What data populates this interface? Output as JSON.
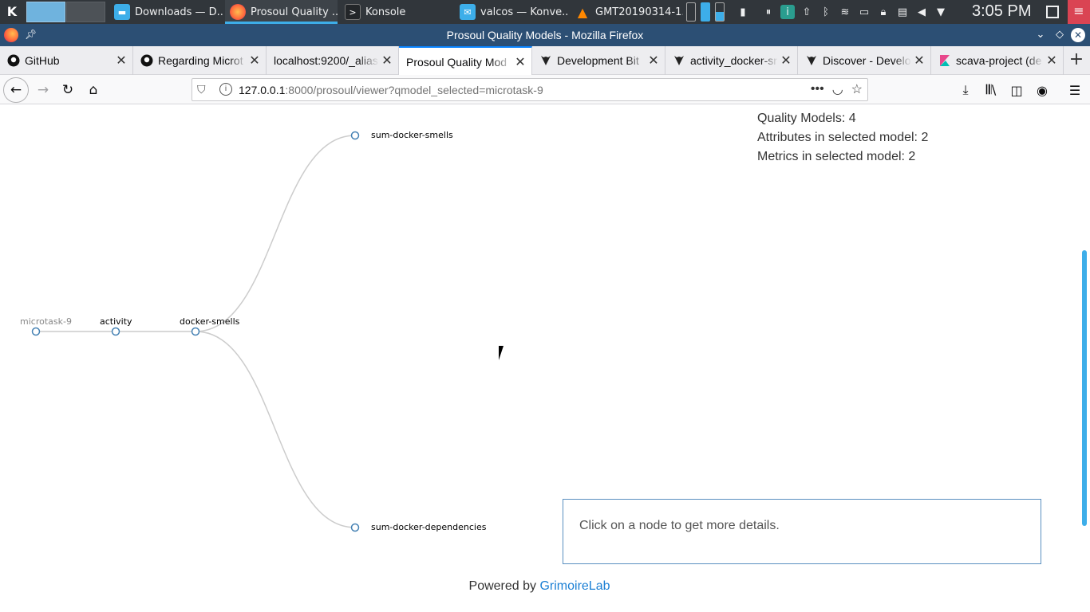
{
  "taskbar": {
    "tasks": [
      {
        "label": "Downloads — D...",
        "icon": "folder-icon"
      },
      {
        "label": "Prosoul Quality ...",
        "icon": "firefox-icon"
      },
      {
        "label": "Konsole",
        "icon": "terminal-icon"
      },
      {
        "label": "valcos — Konve...",
        "icon": "chat-icon"
      },
      {
        "label": "GMT20190314-1...",
        "icon": "vlc-icon"
      }
    ],
    "clock": "3:05 PM"
  },
  "window": {
    "title": "Prosoul Quality Models - Mozilla Firefox"
  },
  "tabs": [
    {
      "title": "GitHub",
      "icon": "github-icon"
    },
    {
      "title": "Regarding Microt",
      "icon": "github-icon"
    },
    {
      "title": "localhost:9200/_alias",
      "icon": ""
    },
    {
      "title": "Prosoul Quality Mod",
      "icon": ""
    },
    {
      "title": "Development Bit",
      "icon": "bitergia-icon"
    },
    {
      "title": "activity_docker-sr",
      "icon": "bitergia-icon"
    },
    {
      "title": "Discover - Develo",
      "icon": "bitergia-icon"
    },
    {
      "title": "scava-project (de",
      "icon": "kibana-icon"
    }
  ],
  "navbar": {
    "url_host": "127.0.0.1",
    "url_rest": ":8000/prosoul/viewer?qmodel_selected=microtask-9"
  },
  "page": {
    "stats": {
      "quality_models": "Quality Models: 4",
      "attributes": "Attributes in selected model: 2",
      "metrics": "Metrics in selected model: 2"
    },
    "tree": {
      "root": "microtask-9",
      "level1": "activity",
      "level2": "docker-smells",
      "leaf_top": "sum-docker-smells",
      "leaf_bottom": "sum-docker-dependencies"
    },
    "details_hint": "Click on a node to get more details.",
    "footer_prefix": "Powered by ",
    "footer_link": "GrimoireLab"
  }
}
